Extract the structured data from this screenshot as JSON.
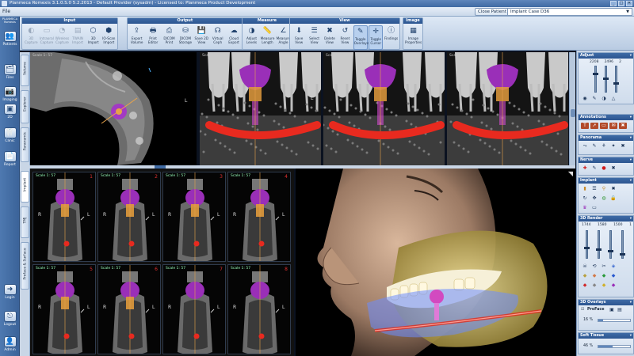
{
  "window": {
    "title": "Planmeca Romexis 3.1.0.S.0   5.2.2013  -  Default Provider (sysadm)  -  Licensed to: Planmeca Product Development",
    "controls": [
      "_",
      "□",
      "✕"
    ]
  },
  "menu": {
    "file": "File"
  },
  "header": {
    "close_patient": "Close Patient",
    "case_value": "Implant Case D36"
  },
  "sidebar": {
    "logo": "PLANMECA Romexis",
    "items": [
      {
        "label": "Patients",
        "icon": "patients-icon",
        "glyph": "👥"
      },
      {
        "label": "Files",
        "icon": "files-icon",
        "glyph": "🗂"
      },
      {
        "label": "Imaging",
        "icon": "imaging-icon",
        "glyph": "📷"
      },
      {
        "label": "2D",
        "icon": "2d-icon",
        "glyph": "▣"
      },
      {
        "label": "Clinic",
        "icon": "clinic-icon",
        "glyph": "🦷"
      },
      {
        "label": "Report",
        "icon": "report-icon",
        "glyph": "📄"
      },
      {
        "label": "Login",
        "icon": "login-icon",
        "glyph": "➜"
      },
      {
        "label": "Logout",
        "icon": "logout-icon",
        "glyph": "⎋"
      },
      {
        "label": "Admin",
        "icon": "admin-icon",
        "glyph": "👤"
      }
    ]
  },
  "ribbon": {
    "groups": [
      {
        "title": "Input",
        "buttons": [
          {
            "label": "3D Capture",
            "glyph": "◐",
            "dim": true
          },
          {
            "label": "Intraoral Capture",
            "glyph": "▭",
            "dim": true
          },
          {
            "label": "Wireless Capture",
            "glyph": "◔",
            "dim": true
          },
          {
            "label": "TWAIN Import",
            "glyph": "▤",
            "dim": true
          },
          {
            "label": "3D Import",
            "glyph": "⬡",
            "dim": false
          },
          {
            "label": "IO-Scan Import",
            "glyph": "⬢",
            "dim": false
          }
        ]
      },
      {
        "title": "Output",
        "buttons": [
          {
            "label": "Export Volume",
            "glyph": "⇪"
          },
          {
            "label": "Print Editor",
            "glyph": "🖶"
          },
          {
            "label": "DICOM Print",
            "glyph": "⎙"
          },
          {
            "label": "DICOM Storage",
            "glyph": "⛁"
          },
          {
            "label": "Save 2D View",
            "glyph": "💾"
          },
          {
            "label": "Virtual Ceph",
            "glyph": "☊"
          },
          {
            "label": "Cloud Export",
            "glyph": "☁"
          }
        ]
      },
      {
        "title": "Measure",
        "buttons": [
          {
            "label": "Adjust Levels",
            "glyph": "◑"
          },
          {
            "label": "Measure Length",
            "glyph": "📏"
          },
          {
            "label": "Measure Angle",
            "glyph": "∠"
          }
        ]
      },
      {
        "title": "View",
        "buttons": [
          {
            "label": "Save View",
            "glyph": "⬇"
          },
          {
            "label": "Select View",
            "glyph": "☰"
          },
          {
            "label": "Delete View",
            "glyph": "✖"
          },
          {
            "label": "Reset View",
            "glyph": "↺"
          },
          {
            "label": "Toggle Overlays",
            "glyph": "✎",
            "active": true
          },
          {
            "label": "Toggle Cursor",
            "glyph": "✛",
            "active": true
          },
          {
            "label": "Findings",
            "glyph": "ⓘ"
          }
        ]
      },
      {
        "title": "Image",
        "buttons": [
          {
            "label": "Image Properties",
            "glyph": "▦"
          }
        ]
      }
    ]
  },
  "views": {
    "axial_side_tabs": [
      "Volume",
      "Explorer",
      "Panoramic"
    ],
    "slice_side_tabs": [
      "Implant",
      "TMJ",
      "Proface & Surface"
    ],
    "scale_label": "Scale 1: 57",
    "orientation_left": "L",
    "orientation_right": "R",
    "slice_numbers": [
      "1",
      "2",
      "3",
      "4",
      "5",
      "6",
      "7",
      "8"
    ]
  },
  "right_panel": {
    "adjust": {
      "title": "Adjust",
      "values": [
        "2208",
        "2496",
        "2"
      ]
    },
    "annotations": {
      "title": "Annotations"
    },
    "panorama": {
      "title": "Panorama"
    },
    "nerve": {
      "title": "Nerve"
    },
    "implant": {
      "title": "Implant"
    },
    "render3d": {
      "title": "3D Render",
      "values": [
        "1744",
        "1580",
        "1500",
        "1"
      ]
    },
    "overlays": {
      "title": "3D Overlays"
    },
    "proface": {
      "label": "ProFace",
      "opacity": "16 %",
      "opacity_value": 16
    },
    "soft_tissue": {
      "title": "Soft Tissue",
      "opacity": "46 %",
      "opacity_value": 46
    }
  },
  "colors": {
    "ribbon_title": "#2c5590",
    "sidebar": "#3b6399",
    "nerve": "#e82a1f",
    "implant": "#e09a3c",
    "tooth_overlay": "#9a2fb8"
  }
}
